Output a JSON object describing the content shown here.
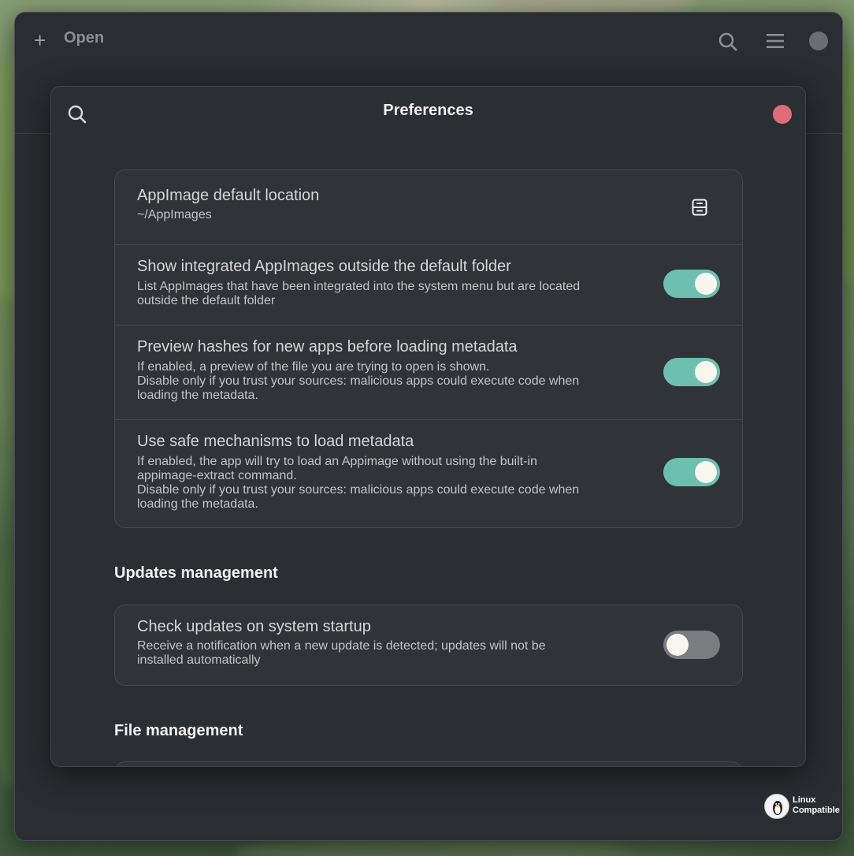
{
  "header": {
    "add_icon": "plus-icon",
    "open_label": "Open",
    "search_icon": "search-icon",
    "menu_icon": "hamburger-menu-icon"
  },
  "dialog": {
    "title": "Preferences",
    "close_color": "#e06c75"
  },
  "general": {
    "location": {
      "title": "AppImage default location",
      "value": "~/AppImages",
      "icon": "file-cabinet-icon"
    },
    "show_integrated": {
      "title": "Show integrated AppImages outside the default folder",
      "lines": [
        "List AppImages that have been integrated into the system menu but are located",
        "outside the default folder"
      ],
      "enabled": true
    },
    "preview_hashes": {
      "title": "Preview hashes for new apps before loading metadata",
      "lines": [
        "If enabled, a preview of the file you are trying to open is shown.",
        "Disable only if you trust your sources: malicious apps could execute code when",
        "loading the metadata."
      ],
      "enabled": true
    },
    "safe_mechanisms": {
      "title": "Use safe mechanisms to load metadata",
      "lines": [
        "If enabled, the app will try to load an Appimage without using the built-in",
        "appimage-extract command.",
        "Disable only if you trust your sources: malicious apps could execute code when",
        "loading the metadata."
      ],
      "enabled": true
    }
  },
  "updates": {
    "section_title": "Updates management",
    "check_startup": {
      "title": "Check updates on system startup",
      "lines": [
        "Receive a notification when a new update is detected; updates will not be",
        "installed automatically"
      ],
      "enabled": false
    }
  },
  "files": {
    "section_title": "File management"
  },
  "watermark": {
    "line1": "Linux",
    "line2": "Compatible"
  },
  "colors": {
    "accent_toggle_on": "#6dbfb0",
    "toggle_off": "#7a7d80",
    "window_bg": "#2a2d31"
  }
}
